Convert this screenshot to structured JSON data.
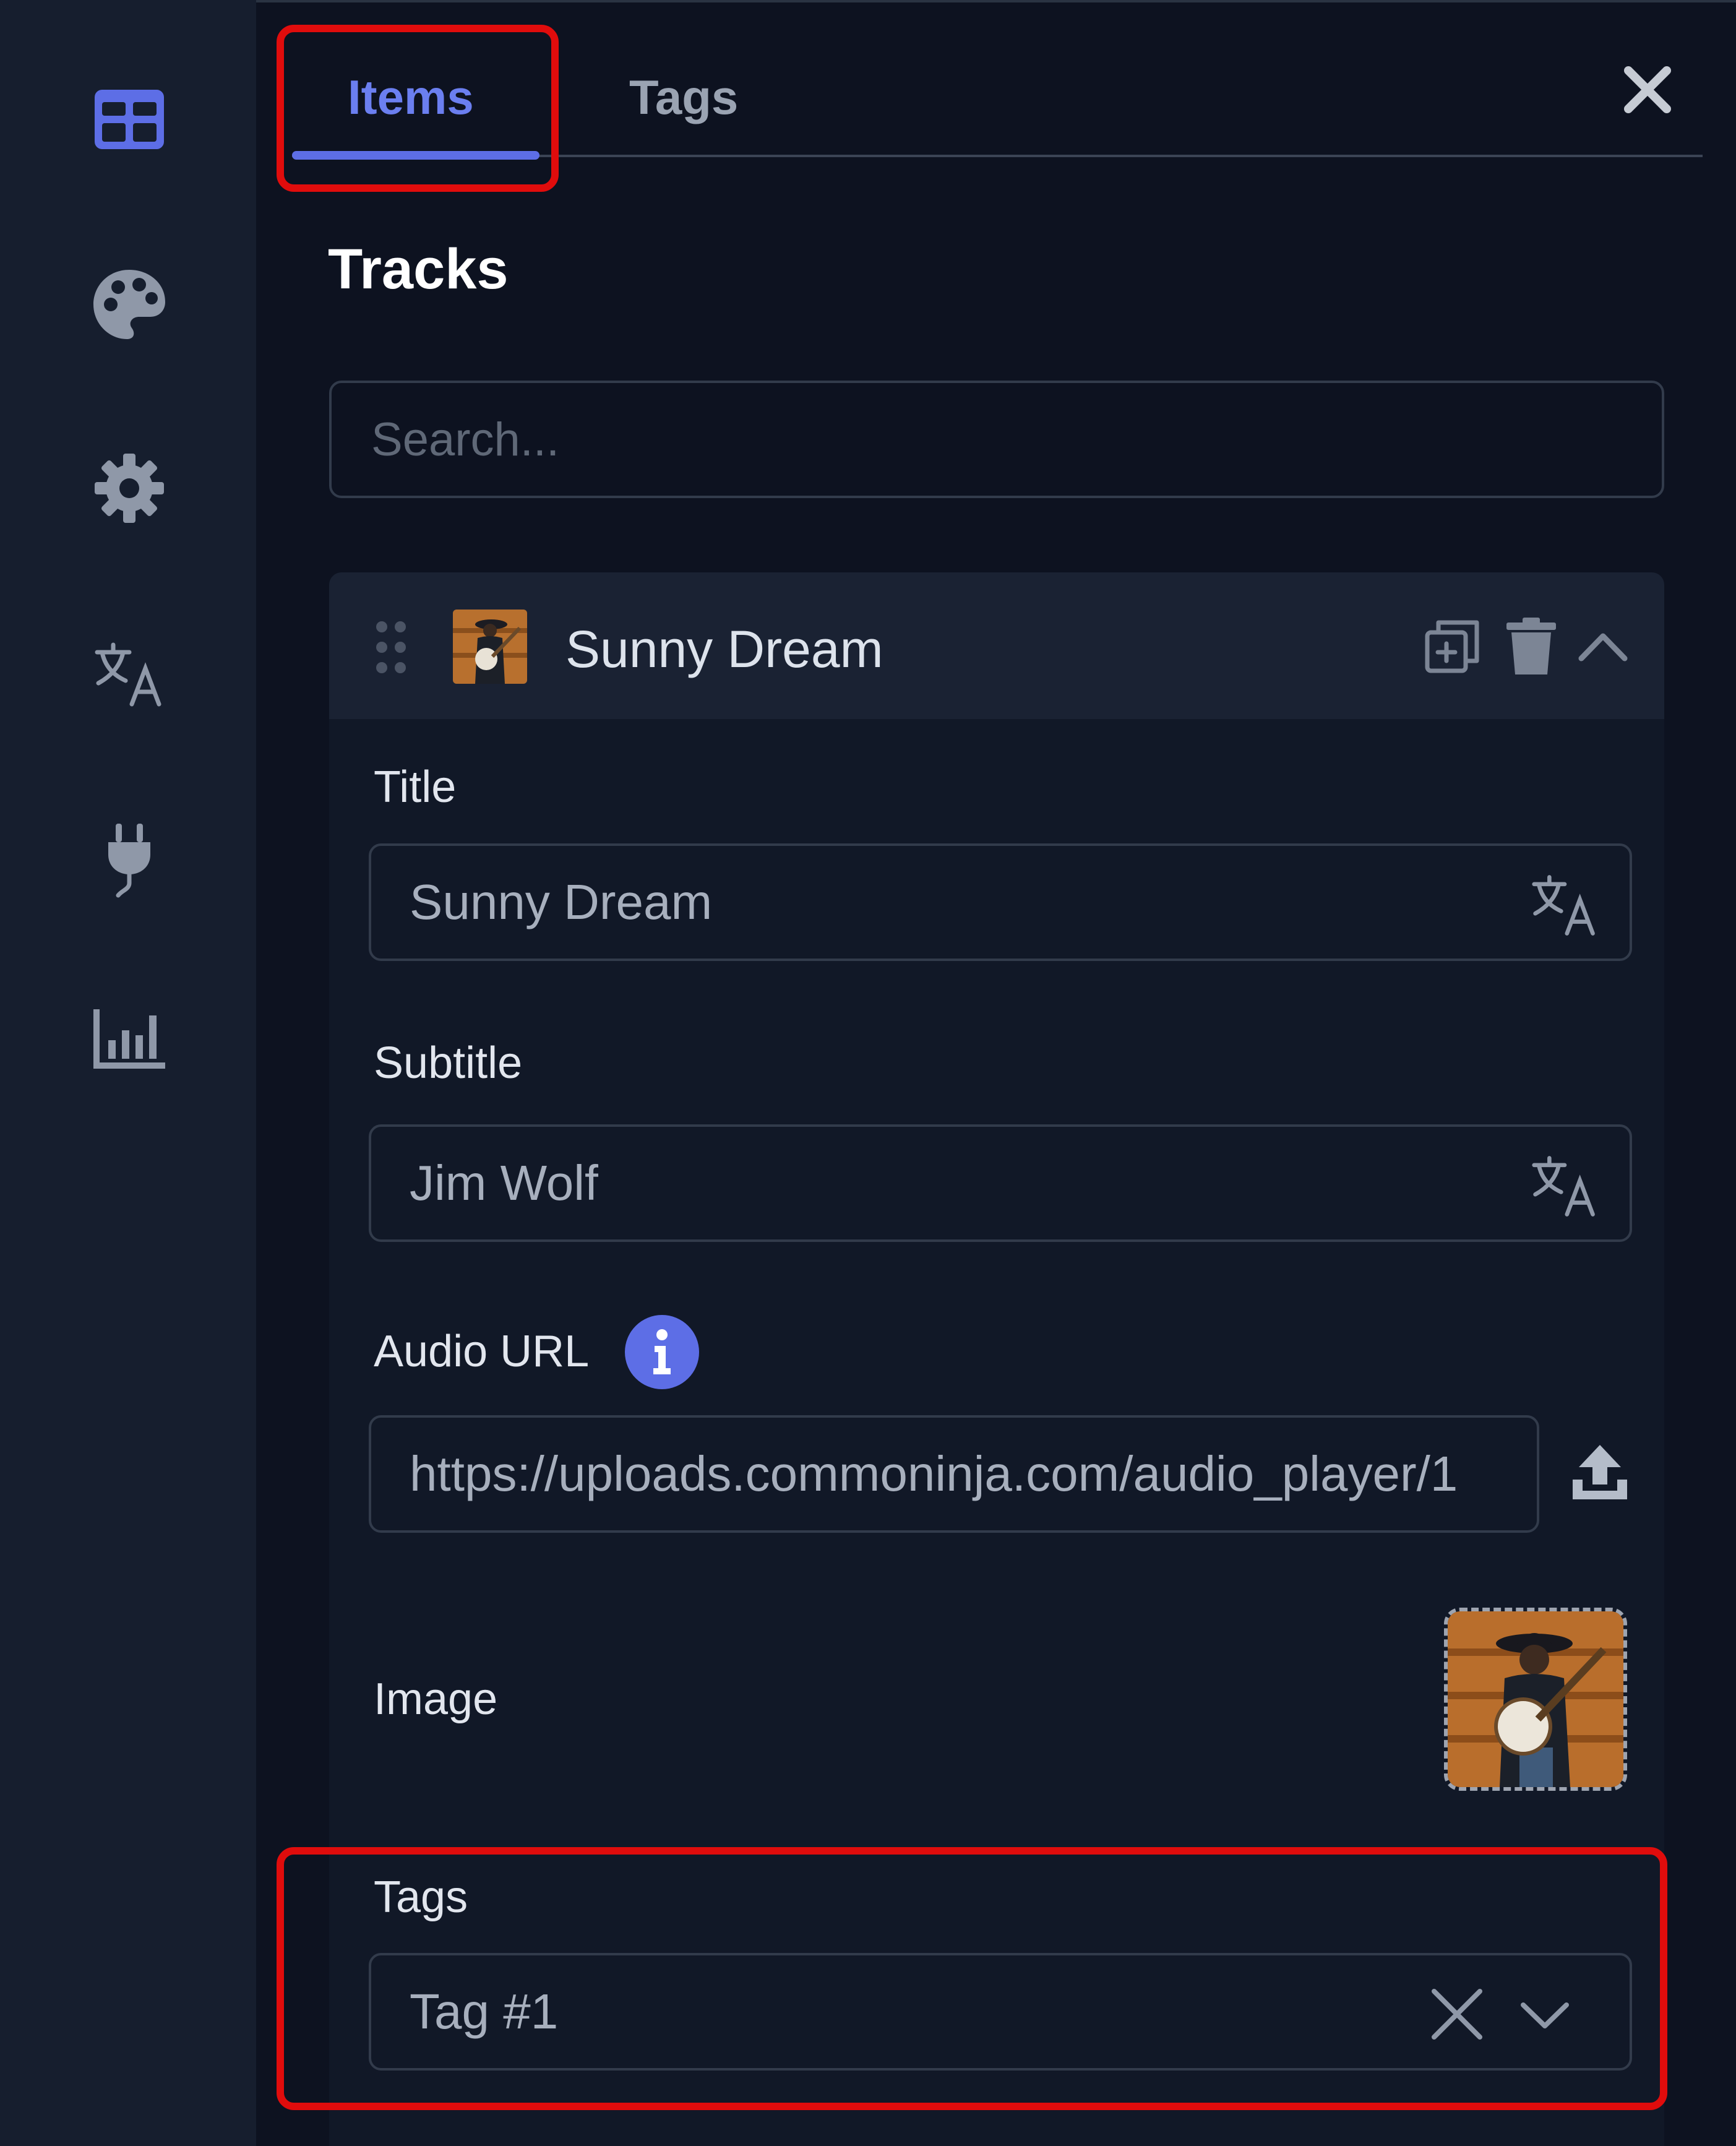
{
  "sidebar": {
    "items": [
      {
        "icon": "grid-icon",
        "active": true
      },
      {
        "icon": "palette-icon"
      },
      {
        "icon": "gear-icon"
      },
      {
        "icon": "translate-icon"
      },
      {
        "icon": "plug-icon"
      },
      {
        "icon": "bar-chart-icon"
      }
    ]
  },
  "tabs": [
    {
      "label": "Items",
      "active": true
    },
    {
      "label": "Tags",
      "active": false
    }
  ],
  "section_title": "Tracks",
  "search": {
    "placeholder": "Search..."
  },
  "track": {
    "name": "Sunny Dream",
    "title_label": "Title",
    "title_value": "Sunny Dream",
    "subtitle_label": "Subtitle",
    "subtitle_value": "Jim Wolf",
    "audio_label": "Audio URL",
    "audio_value": "https://uploads.commoninja.com/audio_player/1",
    "image_label": "Image",
    "tags_label": "Tags",
    "tags_value": "Tag #1"
  },
  "colors": {
    "accent": "#5d6ee6",
    "highlight": "#e00c0c",
    "background": "#0d1220",
    "sidebar": "#161e2e"
  }
}
